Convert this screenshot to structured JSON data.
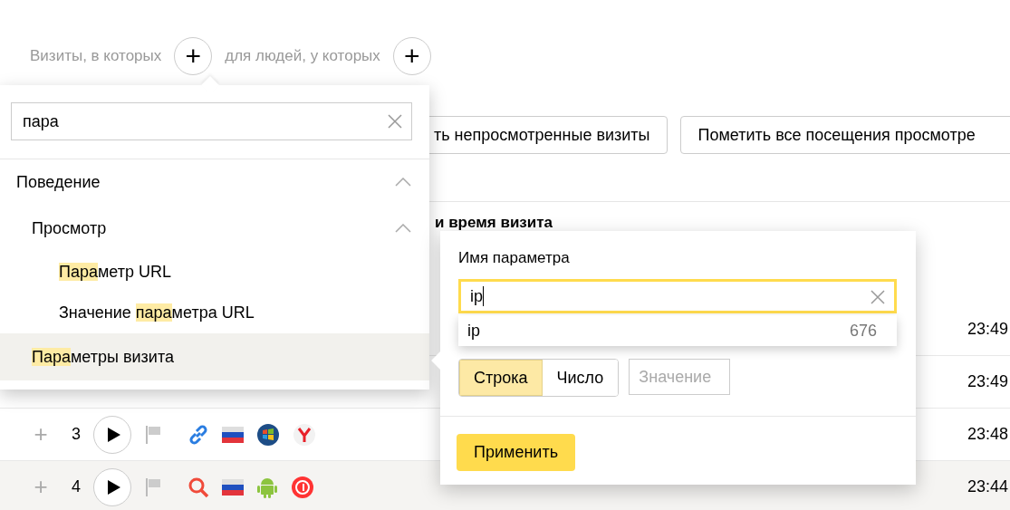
{
  "filter_bar": {
    "visits_label": "Визиты, в которых",
    "people_label": "для людей, у которых",
    "add_visit_condition": "+",
    "add_people_condition": "+"
  },
  "actions": [
    "ть непросмотренные визиты",
    "Пометить все посещения просмотре"
  ],
  "table": {
    "header": "и время визита",
    "rows": [
      {
        "time": "23:49",
        "highlighted": false
      },
      {
        "time": "23:49",
        "highlighted": false
      },
      {
        "expand": "+",
        "number": "3",
        "icons": [
          {
            "kind": "link"
          },
          {
            "kind": "flag-ru"
          },
          {
            "kind": "windows"
          },
          {
            "kind": "yandex-browser"
          }
        ],
        "time": "23:48",
        "highlighted": false
      },
      {
        "expand": "+",
        "number": "4",
        "icons": [
          {
            "kind": "search"
          },
          {
            "kind": "flag-ru"
          },
          {
            "kind": "android"
          },
          {
            "kind": "yandex"
          }
        ],
        "time": "23:44",
        "highlighted": true
      }
    ]
  },
  "condition_menu": {
    "search": {
      "value": "пара"
    },
    "tree": [
      {
        "label": [
          {
            "text": "Поведение",
            "highlight": false
          }
        ],
        "expanded": true,
        "selected": false,
        "children": [
          {
            "label": [
              {
                "text": "Просмотр",
                "highlight": false
              }
            ],
            "expanded": true,
            "selected": false,
            "children": [
              {
                "label": [
                  {
                    "text": "Пара",
                    "highlight": true
                  },
                  {
                    "text": "метр URL",
                    "highlight": false
                  }
                ],
                "selected": false
              },
              {
                "label": [
                  {
                    "text": "Значение ",
                    "highlight": false
                  },
                  {
                    "text": "пара",
                    "highlight": true
                  },
                  {
                    "text": "метра URL",
                    "highlight": false
                  }
                ],
                "selected": false
              }
            ]
          },
          {
            "label": [
              {
                "text": "Пара",
                "highlight": true
              },
              {
                "text": "метры визита",
                "highlight": false
              }
            ],
            "selected": true
          }
        ]
      }
    ]
  },
  "param_popup": {
    "label": "Имя параметра",
    "input": {
      "value": "ip",
      "focused": true
    },
    "suggestions": [
      {
        "name": "ip",
        "count": "676"
      }
    ],
    "types": [
      {
        "label": "Строка",
        "selected": true
      },
      {
        "label": "Число",
        "selected": false
      }
    ],
    "value_field": {
      "placeholder": "Значение",
      "disabled": true
    },
    "apply": "Применить"
  }
}
